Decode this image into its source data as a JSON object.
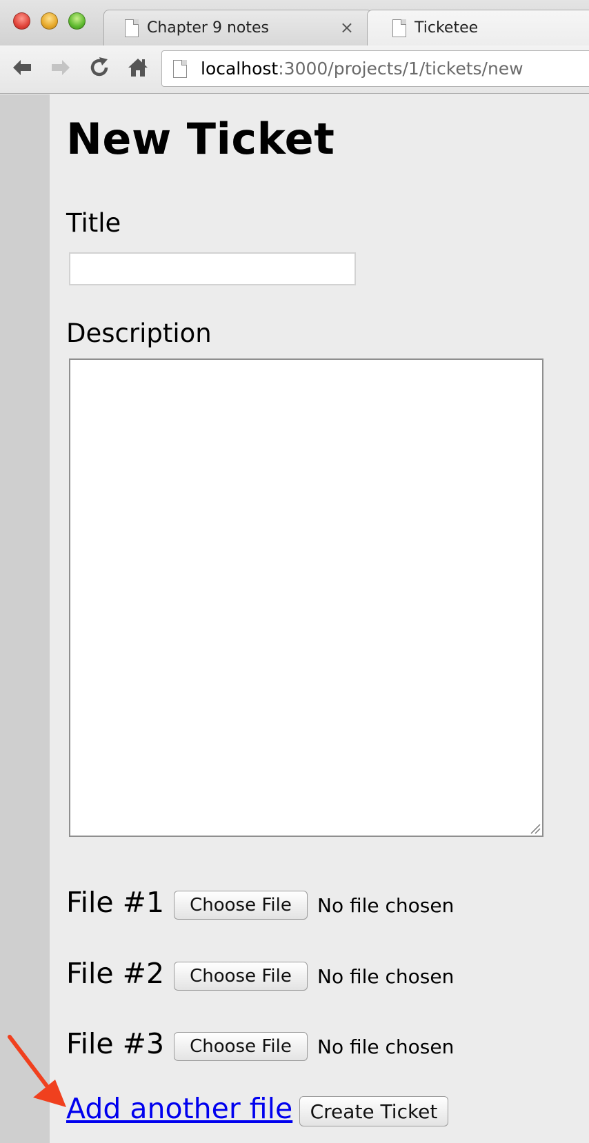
{
  "window": {
    "tabs": [
      {
        "label": "Chapter 9 notes",
        "active": false,
        "close_glyph": "×"
      },
      {
        "label": "Ticketee",
        "active": true
      }
    ]
  },
  "toolbar": {
    "url_host": "localhost",
    "url_rest": ":3000/projects/1/tickets/new"
  },
  "page": {
    "heading": "New Ticket",
    "title_label": "Title",
    "title_value": "",
    "description_label": "Description",
    "description_value": "",
    "files": [
      {
        "label": "File #1",
        "button": "Choose File",
        "status": "No file chosen"
      },
      {
        "label": "File #2",
        "button": "Choose File",
        "status": "No file chosen"
      },
      {
        "label": "File #3",
        "button": "Choose File",
        "status": "No file chosen"
      }
    ],
    "add_file_link": "Add another file",
    "submit_button": "Create Ticket"
  },
  "colors": {
    "link": "#0000ee",
    "annotation_arrow": "#f0401e",
    "page_background": "#ececec",
    "gutter": "#cfcfcf"
  },
  "icons": [
    "back-arrow-icon",
    "forward-arrow-icon",
    "reload-icon",
    "home-icon",
    "page-icon",
    "close-icon",
    "resize-grip-icon",
    "annotation-arrow-icon"
  ]
}
